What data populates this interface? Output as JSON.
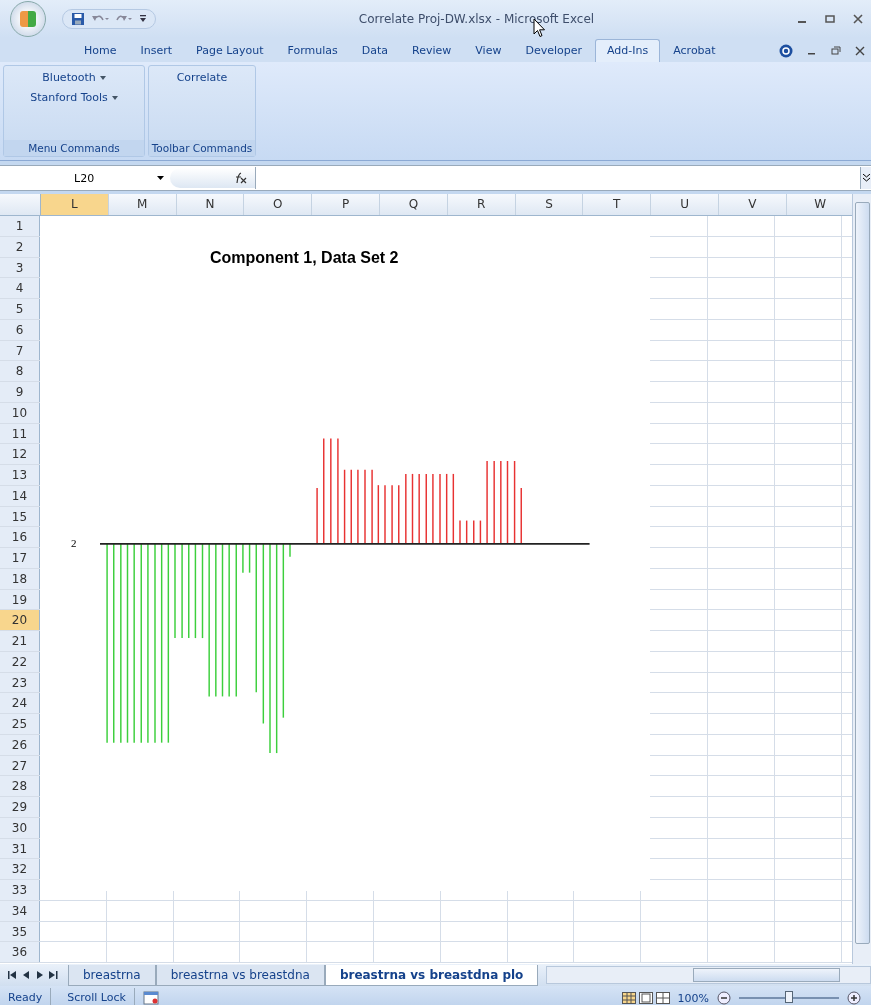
{
  "window": {
    "title": "Correlate Proj-DW.xlsx - Microsoft Excel"
  },
  "ribbon_tabs": [
    {
      "label": "Home",
      "selected": false
    },
    {
      "label": "Insert",
      "selected": false
    },
    {
      "label": "Page Layout",
      "selected": false
    },
    {
      "label": "Formulas",
      "selected": false
    },
    {
      "label": "Data",
      "selected": false
    },
    {
      "label": "Review",
      "selected": false
    },
    {
      "label": "View",
      "selected": false
    },
    {
      "label": "Developer",
      "selected": false
    },
    {
      "label": "Add-Ins",
      "selected": true
    },
    {
      "label": "Acrobat",
      "selected": false
    }
  ],
  "ribbon_groups": [
    {
      "label": "Menu Commands",
      "items": [
        {
          "label": "Bluetooth",
          "kind": "dropdown"
        },
        {
          "label": "Stanford Tools",
          "kind": "dropdown"
        }
      ]
    },
    {
      "label": "Toolbar Commands",
      "items": [
        {
          "label": "Correlate",
          "kind": "button"
        }
      ]
    }
  ],
  "name_box": "L20",
  "columns": [
    {
      "label": "L",
      "selected": true
    },
    {
      "label": "M",
      "selected": false
    },
    {
      "label": "N",
      "selected": false
    },
    {
      "label": "O",
      "selected": false
    },
    {
      "label": "P",
      "selected": false
    },
    {
      "label": "Q",
      "selected": false
    },
    {
      "label": "R",
      "selected": false
    },
    {
      "label": "S",
      "selected": false
    },
    {
      "label": "T",
      "selected": false
    },
    {
      "label": "U",
      "selected": false
    },
    {
      "label": "V",
      "selected": false
    },
    {
      "label": "W",
      "selected": false
    }
  ],
  "rows": [
    {
      "label": "1",
      "selected": false
    },
    {
      "label": "2",
      "selected": false
    },
    {
      "label": "3",
      "selected": false
    },
    {
      "label": "4",
      "selected": false
    },
    {
      "label": "5",
      "selected": false
    },
    {
      "label": "6",
      "selected": false
    },
    {
      "label": "7",
      "selected": false
    },
    {
      "label": "8",
      "selected": false
    },
    {
      "label": "9",
      "selected": false
    },
    {
      "label": "10",
      "selected": false
    },
    {
      "label": "11",
      "selected": false
    },
    {
      "label": "12",
      "selected": false
    },
    {
      "label": "13",
      "selected": false
    },
    {
      "label": "14",
      "selected": false
    },
    {
      "label": "15",
      "selected": false
    },
    {
      "label": "16",
      "selected": false
    },
    {
      "label": "17",
      "selected": false
    },
    {
      "label": "18",
      "selected": false
    },
    {
      "label": "19",
      "selected": false
    },
    {
      "label": "20",
      "selected": true
    },
    {
      "label": "21",
      "selected": false
    },
    {
      "label": "22",
      "selected": false
    },
    {
      "label": "23",
      "selected": false
    },
    {
      "label": "24",
      "selected": false
    },
    {
      "label": "25",
      "selected": false
    },
    {
      "label": "26",
      "selected": false
    },
    {
      "label": "27",
      "selected": false
    },
    {
      "label": "28",
      "selected": false
    },
    {
      "label": "29",
      "selected": false
    },
    {
      "label": "30",
      "selected": false
    },
    {
      "label": "31",
      "selected": false
    },
    {
      "label": "32",
      "selected": false
    },
    {
      "label": "33",
      "selected": false
    },
    {
      "label": "34",
      "selected": false
    },
    {
      "label": "35",
      "selected": false
    },
    {
      "label": "36",
      "selected": false
    }
  ],
  "chart": {
    "title": "Component 1, Data Set 2",
    "axis_label": "2"
  },
  "sheet_tabs": [
    {
      "label": "breastrna",
      "selected": false
    },
    {
      "label": "breastrna vs breastdna",
      "selected": false
    },
    {
      "label": "breastrna vs breastdna plo",
      "selected": true
    }
  ],
  "status_bar": {
    "items": [
      "Ready",
      "Scroll Lock"
    ],
    "zoom": "100%",
    "zoom_slider": {
      "level": 0.5
    }
  }
}
